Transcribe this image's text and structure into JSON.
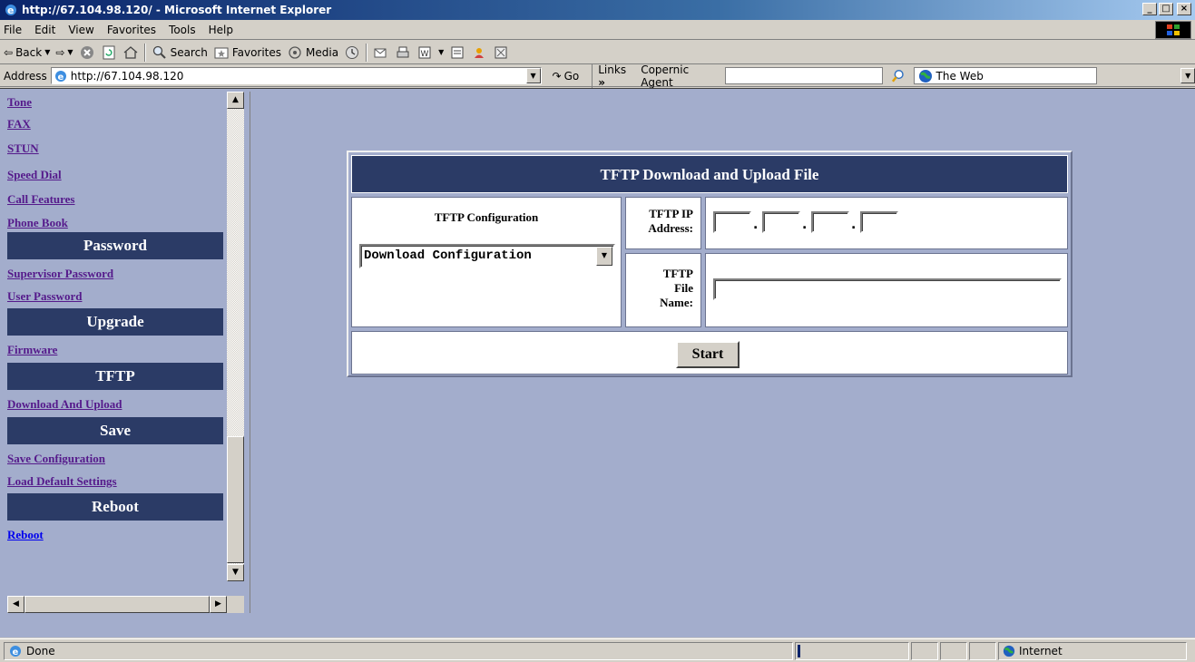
{
  "window": {
    "title": "http://67.104.98.120/ - Microsoft Internet Explorer"
  },
  "menu": [
    "File",
    "Edit",
    "View",
    "Favorites",
    "Tools",
    "Help"
  ],
  "toolbar": {
    "back": "Back",
    "search": "Search",
    "favorites": "Favorites",
    "media": "Media"
  },
  "addressbar": {
    "label": "Address",
    "url": "http://67.104.98.120",
    "go": "Go",
    "links": "Links",
    "agent": "Copernic Agent",
    "search_scope": "The Web"
  },
  "nav": {
    "items_top": [
      "Tone",
      "FAX",
      "STUN",
      "Speed Dial",
      "Call Features",
      "Phone Book"
    ],
    "password_header": "Password",
    "password_items": [
      "Supervisor Password",
      "User Password"
    ],
    "upgrade_header": "Upgrade",
    "upgrade_items": [
      "Firmware"
    ],
    "tftp_header": "TFTP",
    "tftp_items": [
      "Download And Upload"
    ],
    "save_header": "Save",
    "save_items": [
      "Save Configuration",
      "Load Default Settings"
    ],
    "reboot_header": "Reboot",
    "reboot_items": [
      "Reboot"
    ]
  },
  "tftp": {
    "title": "TFTP Download and Upload File",
    "config_label": "TFTP Configuration",
    "config_selected": "Download Configuration",
    "ip_label_line1": "TFTP IP",
    "ip_label_line2": "Address:",
    "ip_octets": [
      "",
      "",
      "",
      ""
    ],
    "file_label_line1": "TFTP",
    "file_label_line2": "File",
    "file_label_line3": "Name:",
    "file_name": "",
    "start_button": "Start"
  },
  "status": {
    "text": "Done",
    "zone": "Internet"
  }
}
